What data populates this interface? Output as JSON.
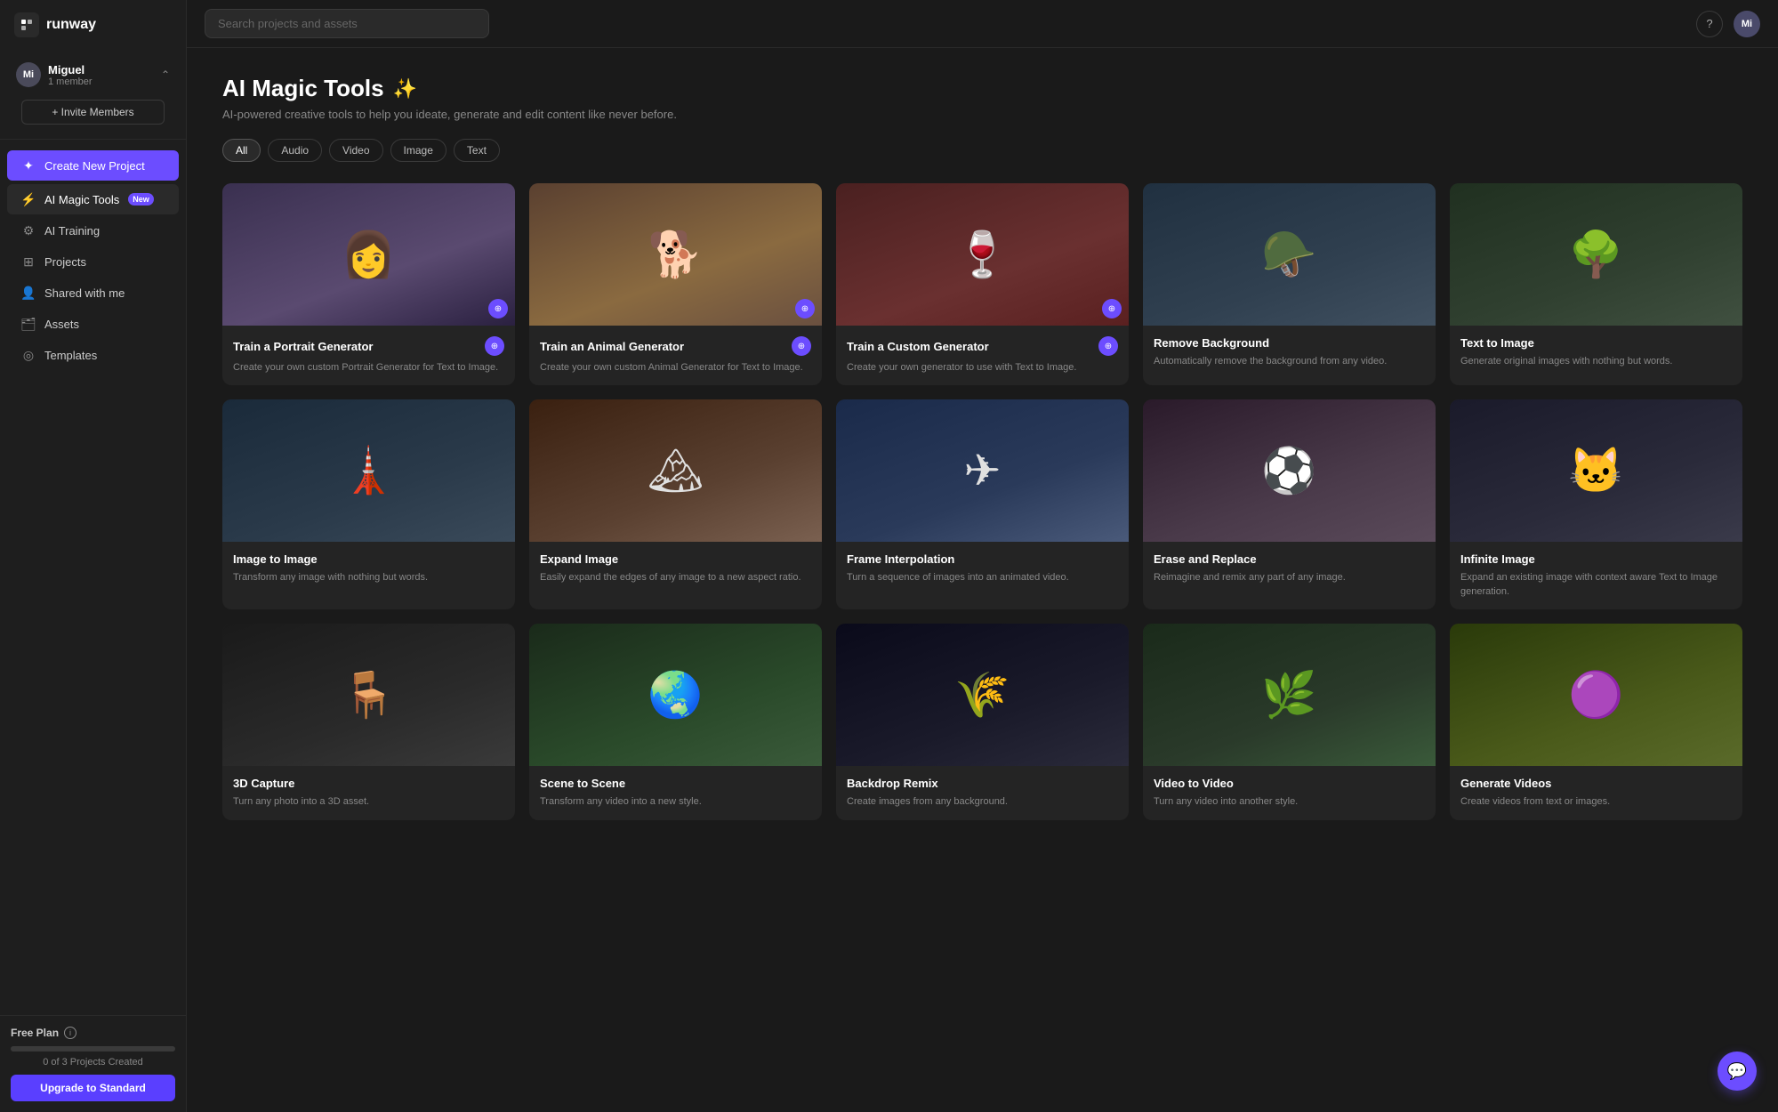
{
  "logo": {
    "icon": "R",
    "text": "runway"
  },
  "workspace": {
    "avatar": "Mi",
    "name": "Miguel",
    "sub": "1 member"
  },
  "invite_button": "+ Invite Members",
  "nav": {
    "create_project": "Create New Project",
    "ai_magic_tools": "AI Magic Tools",
    "ai_magic_tools_badge": "New",
    "ai_training": "AI Training",
    "projects": "Projects",
    "shared_with_me": "Shared with me",
    "assets": "Assets",
    "templates": "Templates"
  },
  "footer": {
    "plan_label": "Free Plan",
    "info_icon": "i",
    "projects_count": "0 of 3 Projects Created",
    "upgrade_label": "Upgrade to Standard"
  },
  "header": {
    "search_placeholder": "Search projects and assets",
    "help_icon": "?",
    "user_avatar": "Mi"
  },
  "page": {
    "title": "AI Magic Tools",
    "wand_icon": "✨",
    "subtitle": "AI-powered creative tools to help you ideate, generate and edit content like never before.",
    "filters": [
      {
        "label": "All",
        "active": true
      },
      {
        "label": "Audio",
        "active": false
      },
      {
        "label": "Video",
        "active": false
      },
      {
        "label": "Image",
        "active": false
      },
      {
        "label": "Text",
        "active": false
      }
    ]
  },
  "tools": [
    {
      "id": "portrait-generator",
      "title": "Train a Portrait Generator",
      "desc": "Create your own custom Portrait Generator for Text to Image.",
      "bg": "portrait",
      "has_badge": true
    },
    {
      "id": "animal-generator",
      "title": "Train an Animal Generator",
      "desc": "Create your own custom Animal Generator for Text to Image.",
      "bg": "animal",
      "has_badge": true
    },
    {
      "id": "custom-generator",
      "title": "Train a Custom Generator",
      "desc": "Create your own generator to use with Text to Image.",
      "bg": "custom",
      "has_badge": true
    },
    {
      "id": "remove-background",
      "title": "Remove Background",
      "desc": "Automatically remove the background from any video.",
      "bg": "remove",
      "has_badge": false
    },
    {
      "id": "text-to-image",
      "title": "Text to Image",
      "desc": "Generate original images with nothing but words.",
      "bg": "text2img",
      "has_badge": false
    },
    {
      "id": "image-to-image",
      "title": "Image to Image",
      "desc": "Transform any image with nothing but words.",
      "bg": "img2img",
      "has_badge": false
    },
    {
      "id": "expand-image",
      "title": "Expand Image",
      "desc": "Easily expand the edges of any image to a new aspect ratio.",
      "bg": "expand",
      "has_badge": false
    },
    {
      "id": "frame-interpolation",
      "title": "Frame Interpolation",
      "desc": "Turn a sequence of images into an animated video.",
      "bg": "frame",
      "has_badge": false
    },
    {
      "id": "erase-and-replace",
      "title": "Erase and Replace",
      "desc": "Reimagine and remix any part of any image.",
      "bg": "erase",
      "has_badge": false
    },
    {
      "id": "infinite-image",
      "title": "Infinite Image",
      "desc": "Expand an existing image with context aware Text to Image generation.",
      "bg": "infinite",
      "has_badge": false
    },
    {
      "id": "row3a",
      "title": "3D Capture",
      "desc": "Turn any photo into a 3D asset.",
      "bg": "row3a",
      "has_badge": false
    },
    {
      "id": "row3b",
      "title": "Scene to Scene",
      "desc": "Transform any video into a new style.",
      "bg": "row3b",
      "has_badge": false
    },
    {
      "id": "row3c",
      "title": "Backdrop Remix",
      "desc": "Create images from any background.",
      "bg": "row3c",
      "has_badge": false
    },
    {
      "id": "row3d",
      "title": "Video to Video",
      "desc": "Turn any video into another style.",
      "bg": "row3d",
      "has_badge": false
    },
    {
      "id": "row3e",
      "title": "Generate Videos",
      "desc": "Create videos from text or images.",
      "bg": "row3e",
      "has_badge": false
    }
  ]
}
